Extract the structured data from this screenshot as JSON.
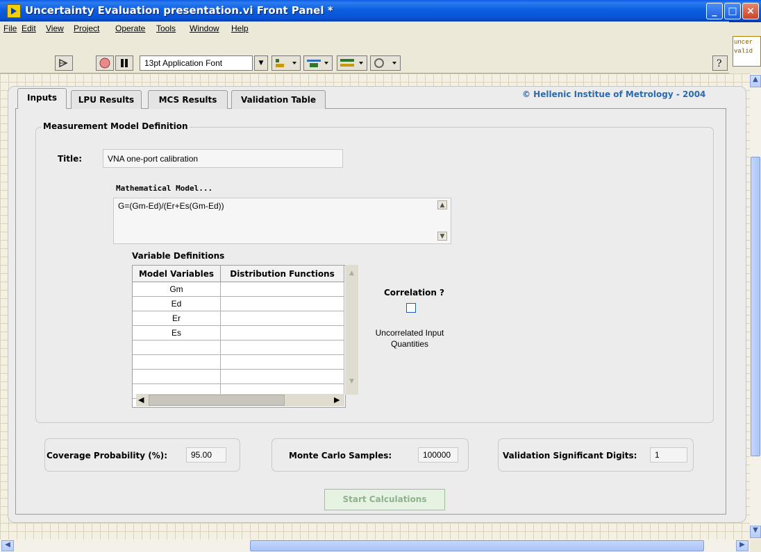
{
  "window": {
    "title": "Uncertainty Evaluation presentation.vi Front Panel *"
  },
  "menu": [
    "File",
    "Edit",
    "View",
    "Project",
    "Operate",
    "Tools",
    "Window",
    "Help"
  ],
  "toolbar": {
    "font": "13pt Application Font"
  },
  "side_panel": {
    "line1": "uncer",
    "line2": "valid"
  },
  "tabs": [
    "Inputs",
    "LPU Results",
    "MCS Results",
    "Validation Table"
  ],
  "active_tab": "Inputs",
  "copyright": "© Hellenic Institue of Metrology - 2004",
  "model": {
    "group_label": "Measurement Model Definition",
    "title_label": "Title:",
    "title_value": "VNA one-port calibration",
    "math_label": "Mathematical Model...",
    "math_value": "G=(Gm-Ed)/(Er+Es(Gm-Ed))"
  },
  "variables": {
    "label": "Variable Definitions",
    "headers": [
      "Model Variables",
      "Distribution Functions"
    ],
    "rows": [
      [
        "Gm",
        ""
      ],
      [
        "Ed",
        ""
      ],
      [
        "Er",
        ""
      ],
      [
        "Es",
        ""
      ],
      [
        "",
        ""
      ],
      [
        "",
        ""
      ],
      [
        "",
        ""
      ],
      [
        "",
        ""
      ]
    ]
  },
  "correlation": {
    "label": "Correlation ?",
    "checked": false,
    "status": "Uncorrelated Input Quantities"
  },
  "coverage": {
    "label": "Coverage Probability (%):",
    "value": "95.00"
  },
  "monte_carlo": {
    "label": "Monte Carlo Samples:",
    "value": "100000"
  },
  "validation": {
    "label": "Validation Significant Digits:",
    "value": "1"
  },
  "start_button": "Start Calculations",
  "colors": {
    "titlebar": "#0a5ce6",
    "copyright": "#2a6bb0",
    "start_disabled": "#8fb08c"
  }
}
